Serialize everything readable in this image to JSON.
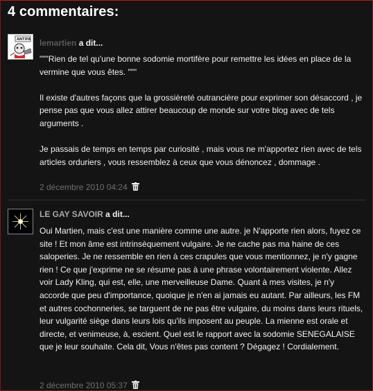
{
  "heading": "4 commentaires:",
  "comments": [
    {
      "author": "lemartien",
      "said": "a dit...",
      "avatar_icon": "cartoon-avatar-icon",
      "paragraphs": [
        "\"\"\"Rien de tel qu'une bonne sodomie mortifère pour remettre les idées en place de la vermine que vous êtes. \"\"\"",
        "Il existe d'autres façons que la grossièreté outrancière pour exprimer son désaccord , je pense pas que vous allez attirer beaucoup de monde sur votre blog avec de tels arguments .",
        "Je passais de temps en temps par curiosité , mais vous ne m'apportez rien avec de tels articles orduriers , vous ressemblez à ceux que vous dénoncez , dommage ."
      ],
      "timestamp": "2 décembre 2010 04:24",
      "delete_icon": "trash-icon"
    },
    {
      "author": "LE GAY SAVOIR",
      "said": "a dit...",
      "avatar_icon": "star-burst-avatar-icon",
      "paragraphs": [
        "Oui Martien, mais c'est une manière comme une autre. je N'apporte rien alors, fuyez ce site ! Et mon âme est intrinsèquement vulgaire. Je ne cache pas ma haine de ces saloperies. Je ne ressemble en rien à ces crapules que vous mentionnez, je n'y gagne rien ! Ce que j'exprime ne se résume pas à une phrase volontairement violente. Allez voir Lady Kling, qui est, elle, une merveilleuse Dame. Quant à mes visites, je n'y accorde que peu d'importance, quoique je n'en ai jamais eu autant. Par ailleurs, les FM et autres cochonneries, se targuent de ne pas être vulgaire, du moins dans leurs rituels, leur vulgarité siège dans leurs lois qu'ils imposent au peuple. La mienne est orale et directe, et venimeuse, à, escient. Quel est le rapport avec la sodomie SENEGALAISE que je leur souhaite. Cela dit, Vous n'êtes pas content ? Dégagez ! Cordialement."
      ],
      "timestamp": "2 décembre 2010 05:37",
      "delete_icon": "trash-icon"
    }
  ]
}
